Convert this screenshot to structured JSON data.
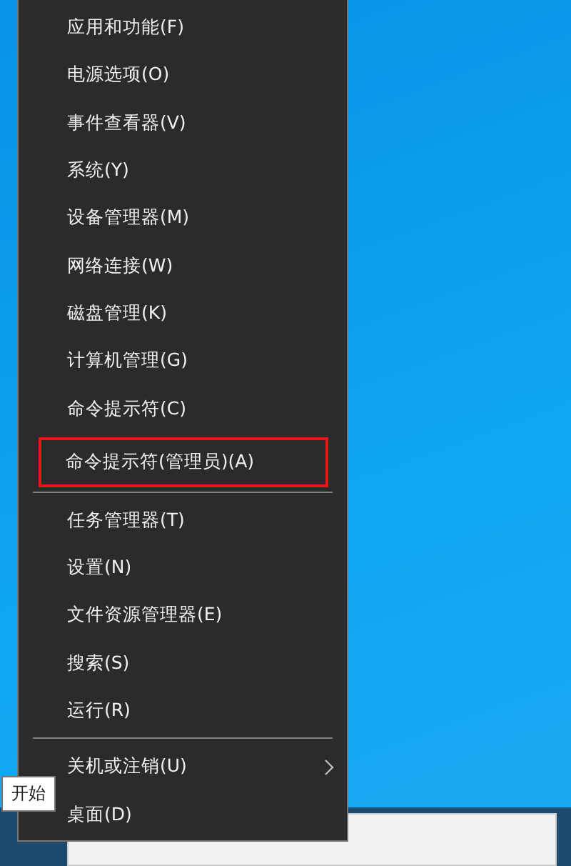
{
  "menu": {
    "groups": [
      {
        "items": [
          {
            "label": "应用和功能(F)",
            "submenu": false,
            "highlighted": false
          },
          {
            "label": "电源选项(O)",
            "submenu": false,
            "highlighted": false
          },
          {
            "label": "事件查看器(V)",
            "submenu": false,
            "highlighted": false
          },
          {
            "label": "系统(Y)",
            "submenu": false,
            "highlighted": false
          },
          {
            "label": "设备管理器(M)",
            "submenu": false,
            "highlighted": false
          },
          {
            "label": "网络连接(W)",
            "submenu": false,
            "highlighted": false
          },
          {
            "label": "磁盘管理(K)",
            "submenu": false,
            "highlighted": false
          },
          {
            "label": "计算机管理(G)",
            "submenu": false,
            "highlighted": false
          },
          {
            "label": "命令提示符(C)",
            "submenu": false,
            "highlighted": false
          },
          {
            "label": "命令提示符(管理员)(A)",
            "submenu": false,
            "highlighted": true
          }
        ]
      },
      {
        "items": [
          {
            "label": "任务管理器(T)",
            "submenu": false,
            "highlighted": false
          },
          {
            "label": "设置(N)",
            "submenu": false,
            "highlighted": false
          },
          {
            "label": "文件资源管理器(E)",
            "submenu": false,
            "highlighted": false
          },
          {
            "label": "搜索(S)",
            "submenu": false,
            "highlighted": false
          },
          {
            "label": "运行(R)",
            "submenu": false,
            "highlighted": false
          }
        ]
      },
      {
        "items": [
          {
            "label": "关机或注销(U)",
            "submenu": true,
            "highlighted": false
          },
          {
            "label": "桌面(D)",
            "submenu": false,
            "highlighted": false
          }
        ]
      }
    ]
  },
  "tooltip": "开始"
}
